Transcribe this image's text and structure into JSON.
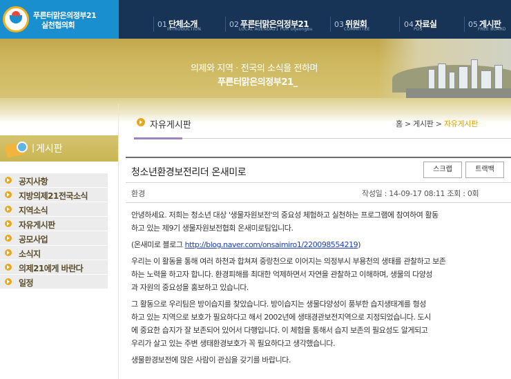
{
  "site": {
    "name_line1": "푸른터맑은의정부21",
    "name_line2": "실천협의회"
  },
  "nav": [
    {
      "num": "01",
      "title": "단체소개",
      "sub": "INTRODUCTION"
    },
    {
      "num": "02",
      "title": "푸른터맑은의정부21",
      "sub": "LOCAL AGENDA21 FOR Uijeongbu"
    },
    {
      "num": "03",
      "title": "위원회",
      "sub": "COMMITTEE"
    },
    {
      "num": "04",
      "title": "자료실",
      "sub": "PDS"
    },
    {
      "num": "05",
      "title": "게시판",
      "sub": "FREE BOARD"
    }
  ],
  "banner": {
    "slogan_line1": "의제와 지역 · 전국의 소식을 전하며",
    "slogan_line2": "푸른터맑은의정부21_"
  },
  "sidebar": {
    "title": "게시판",
    "items": [
      {
        "label": "공지사항"
      },
      {
        "label": "지방의제21전국소식"
      },
      {
        "label": "지역소식"
      },
      {
        "label": "자유게시판"
      },
      {
        "label": "공모사업"
      },
      {
        "label": "소식지"
      },
      {
        "label": "의제21에게 바란다"
      },
      {
        "label": "일정"
      }
    ]
  },
  "board": {
    "label": "자유게시판",
    "breadcrumb": {
      "home": "홈",
      "sep": ">",
      "section": "게시판",
      "current": "자유게시판"
    }
  },
  "post": {
    "title": "청소년환경보전리더 온새미로",
    "scrap_label": "스크랩",
    "trackback_label": "트랙백",
    "category": "환경",
    "meta": "작성일 : 14-09-17 08:11  조회 : 0회",
    "body": {
      "p1_line1": "안녕하세요. 저희는 청소년 대상 '생물자원보전'의 중요성 체험하고 실천하는 프로그램에 참여하여 활동",
      "p1_line2": "하고 있는 제9기 생물자원보전협회 온새미로팀입니다.",
      "blog_prefix": "(온새미로 블로그 ",
      "blog_url": "http://blog.naver.com/onsaimiro1/220098554219",
      "blog_suffix": ")",
      "p3_line1": "우리는 이 활동을 통해 여러 하천과 합쳐져 중랑천으로 이어지는 의정부시 부용천의 생태를 관찰하고 보존",
      "p3_line2": "하는 노력을 하고자 합니다. 환경피해를 최대한 억제하면서 자연을 관찰하고 이해하며, 생물의 다양성",
      "p3_line3": "과 자원의 중요성을 홍보하고 있습니다.",
      "p4_line1": "그 활동으로 우리팀은 방이습지를 찾았습니다. 방이습지는 생물다양성이 풍부한 습지생태계를 형성",
      "p4_line2": "하고 있는 지역으로 보호가 필요하다고 해서 2002년에 생태경관보전지역으로 지정되었습니다. 도시",
      "p4_line3": "에 중요한 습지가 잘 보존되어 있어서 다행입니다. 이 체험을 통해서 습지 보존의 필요성도 알게되고",
      "p4_line4": "우리가 살고 있는 주변 생태환경보호가 꼭 필요하다고 생각했습니다.",
      "p5_line1": "생물환경보전에 많은 사람이 관심을 갖기를 바랍니다."
    }
  },
  "colors": {
    "topbar": "#173457",
    "logo_bg": "#1a8fd0",
    "accent_orange": "#e9a817",
    "banner_gold": "#ceb85f",
    "link_blue": "#1d3fb8"
  }
}
